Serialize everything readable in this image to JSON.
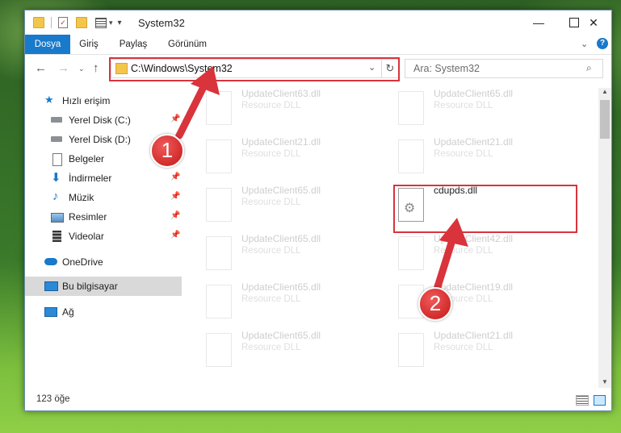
{
  "window": {
    "title": "System32",
    "controls": [
      "minimize",
      "maximize",
      "close"
    ]
  },
  "ribbon": {
    "tabs": [
      "Dosya",
      "Giriş",
      "Paylaş",
      "Görünüm"
    ]
  },
  "navigation": {
    "address": "C:\\Windows\\System32",
    "search_placeholder": "Ara: System32"
  },
  "sidebar": {
    "items": [
      {
        "label": "Hızlı erişim",
        "icon": "star-icon"
      },
      {
        "label": "Yerel Disk (C:)",
        "icon": "drive-icon",
        "pinned": true
      },
      {
        "label": "Yerel Disk (D:)",
        "icon": "drive-icon",
        "pinned": true
      },
      {
        "label": "Belgeler",
        "icon": "documents-icon",
        "pinned": true
      },
      {
        "label": "İndirmeler",
        "icon": "download-icon",
        "pinned": true
      },
      {
        "label": "Müzik",
        "icon": "music-icon",
        "pinned": true
      },
      {
        "label": "Resimler",
        "icon": "pictures-icon",
        "pinned": true
      },
      {
        "label": "Videolar",
        "icon": "video-icon",
        "pinned": true
      },
      {
        "label": "OneDrive",
        "icon": "cloud-icon"
      },
      {
        "label": "Bu bilgisayar",
        "icon": "computer-icon",
        "selected": true
      },
      {
        "label": "Ağ",
        "icon": "network-icon"
      }
    ]
  },
  "files": {
    "left": [
      {
        "name": "UpdateClient63.dll",
        "type": "Resource DLL"
      },
      {
        "name": "UpdateClient21.dll",
        "type": "Resource DLL"
      },
      {
        "name": "UpdateClient65.dll",
        "type": "Resource DLL"
      },
      {
        "name": "UpdateClient65.dll",
        "type": "Resource DLL"
      },
      {
        "name": "UpdateClient65.dll",
        "type": "Resource DLL"
      },
      {
        "name": "UpdateClient65.dll",
        "type": "Resource DLL"
      }
    ],
    "right": [
      {
        "name": "UpdateClient65.dll",
        "type": "Resource DLL"
      },
      {
        "name": "UpdateClient21.dll",
        "type": "Resource DLL"
      },
      {
        "name": "cdupds.dll",
        "type": "",
        "highlighted": true
      },
      {
        "name": "UpdateClient42.dll",
        "type": "Resource DLL"
      },
      {
        "name": "UpdateClient19.dll",
        "type": "Resource DLL"
      },
      {
        "name": "UpdateClient21.dll",
        "type": "Resource DLL"
      }
    ]
  },
  "status": {
    "count": "123 öğe"
  },
  "annotations": {
    "step1": "1",
    "step2": "2",
    "color": "#d9333c"
  }
}
